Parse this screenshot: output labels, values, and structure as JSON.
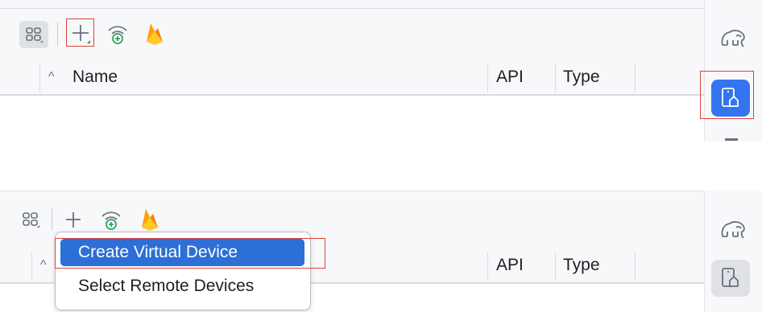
{
  "panels": [
    {
      "toolbar": {
        "icons": [
          "device-grid-icon",
          "add-icon",
          "wifi-pair-icon",
          "firebase-icon"
        ]
      },
      "table": {
        "sort_glyph": "^",
        "columns": [
          "Name",
          "API",
          "Type"
        ]
      },
      "side_strip": {
        "icons": [
          "gradle-elephant-icon",
          "device-manager-icon"
        ],
        "active": "device-manager-icon"
      }
    },
    {
      "toolbar": {
        "icons": [
          "device-grid-icon",
          "add-icon",
          "wifi-pair-icon",
          "firebase-icon"
        ]
      },
      "table": {
        "sort_glyph": "^",
        "columns": [
          "API",
          "Type"
        ]
      },
      "side_strip": {
        "icons": [
          "gradle-elephant-icon",
          "device-manager-icon"
        ],
        "active": ""
      },
      "menu": {
        "items": [
          "Create Virtual Device",
          "Select Remote Devices"
        ],
        "selected": "Create Virtual Device"
      }
    }
  ],
  "colors": {
    "highlight_red": "#e0413b",
    "accent_blue": "#3574f0",
    "menu_selected": "#2c6fd6"
  }
}
